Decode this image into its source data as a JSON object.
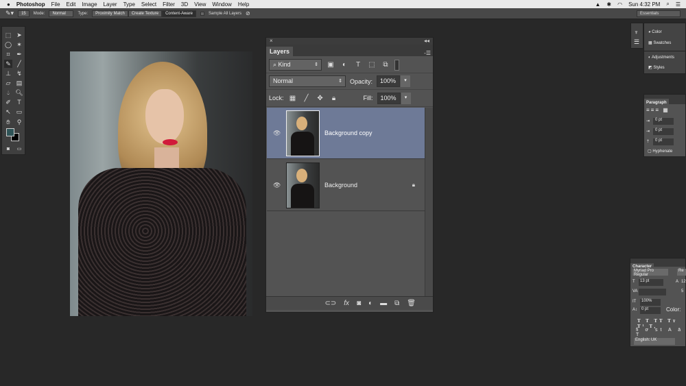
{
  "menubar": {
    "app": "Photoshop",
    "items": [
      "File",
      "Edit",
      "Image",
      "Layer",
      "Type",
      "Select",
      "Filter",
      "3D",
      "View",
      "Window",
      "Help"
    ],
    "clock": "Sun 4:32 PM"
  },
  "options": {
    "brush_size": "15",
    "mode_label": "Mode:",
    "mode_value": "Normal",
    "type_label": "Type:",
    "type_buttons": [
      "Proximity Match",
      "Create Texture",
      "Content-Aware"
    ],
    "sample_all": "Sample All Layers",
    "workspace": "Essentials"
  },
  "tools": {
    "foreground_color": "#2f5457",
    "background_color": "#000000"
  },
  "layers_panel": {
    "title": "Layers",
    "filter": "Kind",
    "blend_mode": "Normal",
    "opacity_label": "Opacity:",
    "opacity": "100%",
    "lock_label": "Lock:",
    "fill_label": "Fill:",
    "fill": "100%",
    "layers": [
      {
        "name": "Background copy",
        "selected": true,
        "visible": true
      },
      {
        "name": "Background",
        "selected": false,
        "visible": true,
        "locked": true
      }
    ],
    "selection_color": "#6e7a97"
  },
  "right_panels": {
    "color": "Color",
    "swatches": "Swatches",
    "adjustments": "Adjustments",
    "styles": "Styles"
  },
  "paragraph": {
    "title": "Paragraph",
    "indent_left": "0 pt",
    "indent_first": "0 pt",
    "space_before": "0 pt",
    "hyphenate": "Hyphenate"
  },
  "character": {
    "title": "Character",
    "font": "Myriad Pro Regular",
    "style": "Re",
    "size": "13 pt",
    "leading": "12",
    "tracking": "5",
    "scale": "100%",
    "baseline": "0 pt",
    "color_label": "Color:",
    "language": "English: UK"
  }
}
